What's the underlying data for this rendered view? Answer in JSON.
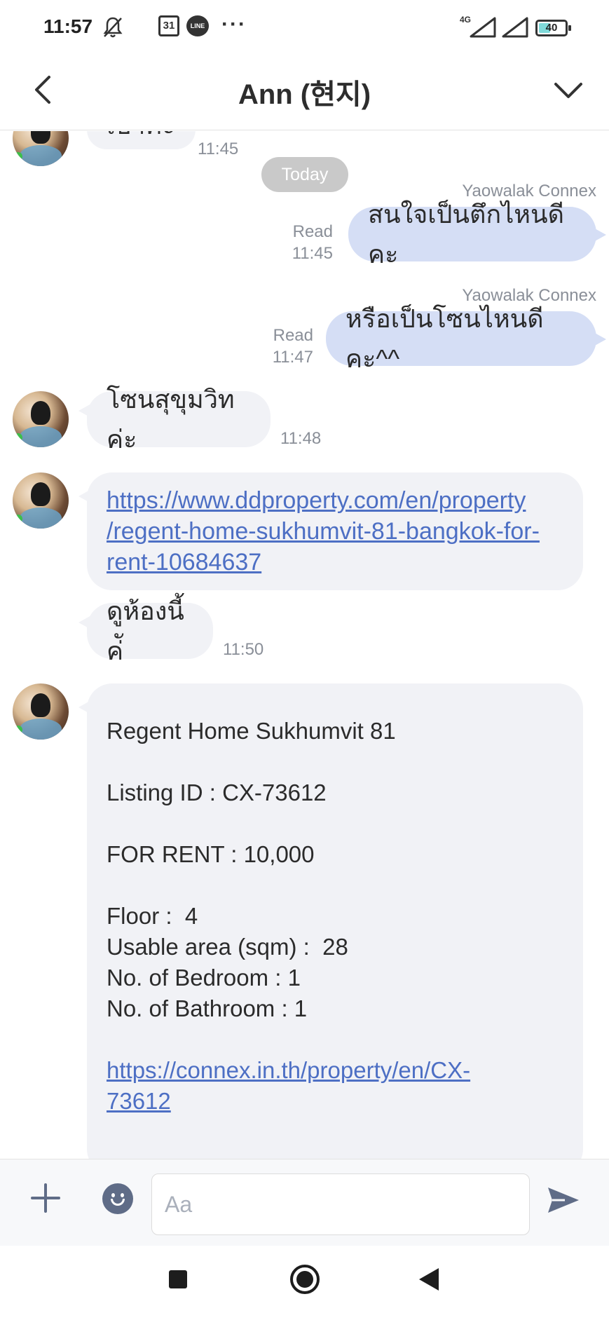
{
  "status_bar": {
    "time": "11:57",
    "calendar_day": "31",
    "line_app_label": "LINE",
    "more": "···",
    "network": "4G",
    "battery": "40"
  },
  "header": {
    "title": "Ann (현지)"
  },
  "chat": {
    "top_partial": {
      "text": "เบาค่ะ",
      "time": "11:45"
    },
    "date_separator": "Today",
    "outgoing": [
      {
        "sender": "Yaowalak Connex",
        "read": "Read",
        "time": "11:45",
        "text": "สนใจเป็นตึกไหนดีคะ"
      },
      {
        "sender": "Yaowalak Connex",
        "read": "Read",
        "time": "11:47",
        "text": "หรือเป็นโซนไหนดีคะ^^"
      }
    ],
    "incoming": [
      {
        "text": "โซนสุขุมวิทค่ะ",
        "time": "11:48"
      },
      {
        "text": "https://www.ddproperty.com/en/property/regent-home-sukhumvit-81-bangkok-for-rent-10684637",
        "lines": [
          "https://www.ddproperty.com/en/property",
          "/regent-home-sukhumvit-81-bangkok-for-",
          "rent-10684637"
        ]
      },
      {
        "text": "ดูห้องนี้ค่ั",
        "time": "11:50"
      }
    ],
    "listing_card": {
      "name": "Regent Home Sukhumvit 81",
      "listing_id": "Listing ID : CX-73612",
      "price": "FOR RENT : 10,000",
      "floor": "Floor :  4",
      "area": "Usable area (sqm) :  28",
      "bedroom": "No. of Bedroom : 1",
      "bathroom": "No. of Bathroom : 1",
      "link_lines": [
        "https://connex.in.th/property/en/CX-",
        "73612"
      ]
    }
  },
  "input": {
    "placeholder": "Aa"
  },
  "colors": {
    "outgoing_bubble": "#d5def5",
    "incoming_bubble": "#f1f2f6",
    "link": "#4d6fc4"
  }
}
